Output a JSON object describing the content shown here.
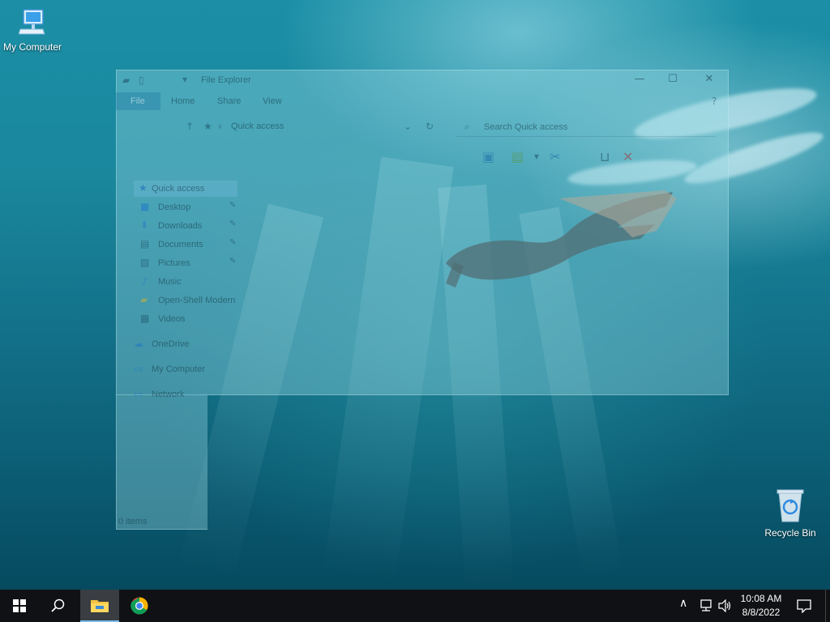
{
  "desktop": {
    "icons": [
      {
        "label": "My Computer",
        "icon": "computer-icon"
      },
      {
        "label": "Recycle Bin",
        "icon": "recycle-bin-icon"
      }
    ]
  },
  "explorer": {
    "title": "File Explorer",
    "ribbon_tabs": [
      "File",
      "Home",
      "Share",
      "View"
    ],
    "address": "Quick access",
    "search_placeholder": "Search Quick access",
    "nav": {
      "quick_access": "Quick access",
      "pinned": [
        "Desktop",
        "Downloads",
        "Documents",
        "Pictures"
      ],
      "others": [
        "Music",
        "Open-Shell Modern",
        "Videos"
      ],
      "onedrive": "OneDrive",
      "my_computer": "My Computer",
      "network": "Network"
    },
    "status": "0 items"
  },
  "taskbar": {
    "clock_time": "10:08 AM",
    "clock_date": "8/8/2022",
    "apps": [
      "file-explorer-icon",
      "chrome-icon"
    ],
    "accent": "#76b9ed"
  }
}
